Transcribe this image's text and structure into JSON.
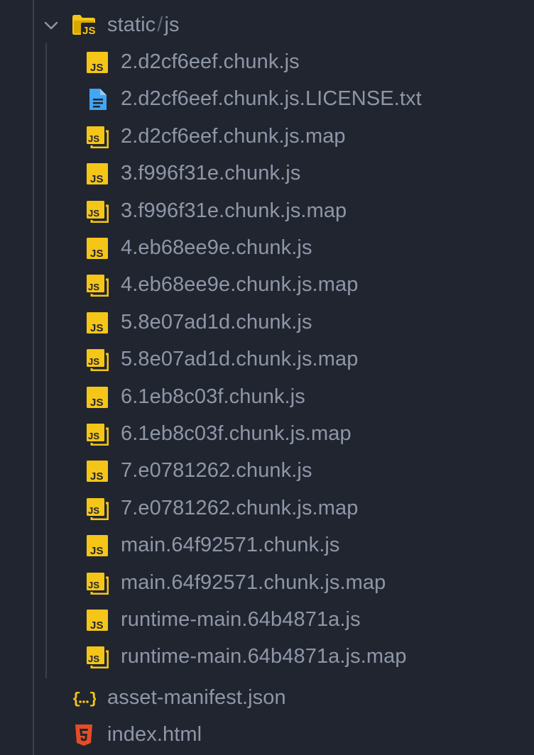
{
  "explorer": {
    "folder": {
      "name_part1": "static",
      "separator": "/",
      "name_part2": "js",
      "expanded": true
    },
    "files": [
      {
        "name": "2.d2cf6eef.chunk.js",
        "type": "js"
      },
      {
        "name": "2.d2cf6eef.chunk.js.LICENSE.txt",
        "type": "txt"
      },
      {
        "name": "2.d2cf6eef.chunk.js.map",
        "type": "jsmap"
      },
      {
        "name": "3.f996f31e.chunk.js",
        "type": "js"
      },
      {
        "name": "3.f996f31e.chunk.js.map",
        "type": "jsmap"
      },
      {
        "name": "4.eb68ee9e.chunk.js",
        "type": "js"
      },
      {
        "name": "4.eb68ee9e.chunk.js.map",
        "type": "jsmap"
      },
      {
        "name": "5.8e07ad1d.chunk.js",
        "type": "js"
      },
      {
        "name": "5.8e07ad1d.chunk.js.map",
        "type": "jsmap"
      },
      {
        "name": "6.1eb8c03f.chunk.js",
        "type": "js"
      },
      {
        "name": "6.1eb8c03f.chunk.js.map",
        "type": "jsmap"
      },
      {
        "name": "7.e0781262.chunk.js",
        "type": "js"
      },
      {
        "name": "7.e0781262.chunk.js.map",
        "type": "jsmap"
      },
      {
        "name": "main.64f92571.chunk.js",
        "type": "js"
      },
      {
        "name": "main.64f92571.chunk.js.map",
        "type": "jsmap"
      },
      {
        "name": "runtime-main.64b4871a.js",
        "type": "js"
      },
      {
        "name": "runtime-main.64b4871a.js.map",
        "type": "jsmap"
      }
    ],
    "root_files": [
      {
        "name": "asset-manifest.json",
        "type": "json"
      },
      {
        "name": "index.html",
        "type": "html"
      }
    ],
    "colors": {
      "background": "#21252f",
      "text": "#8e97a8",
      "js_yellow": "#f5c518",
      "txt_blue": "#42a5f5",
      "html_orange": "#e44d26",
      "json_yellow": "#f5c518",
      "guide": "#3a404c"
    }
  }
}
